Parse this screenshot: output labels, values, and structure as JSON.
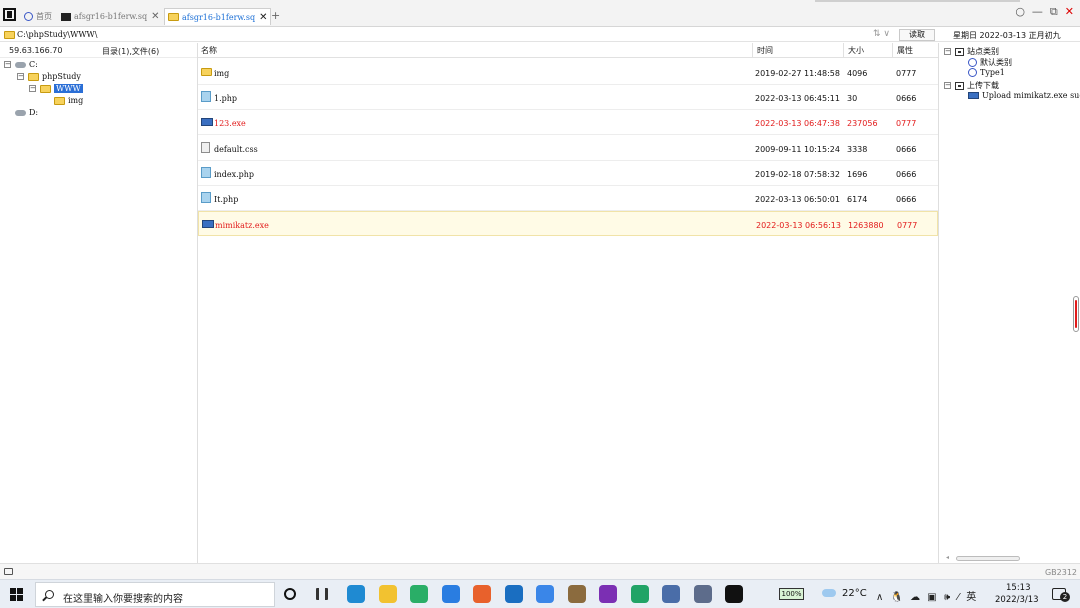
{
  "tabs": [
    {
      "label": "首页",
      "icon": "globe-icon"
    },
    {
      "label": "afsgr16-b1ferw.sq",
      "icon": "terminal-icon"
    },
    {
      "label": "afsgr16-b1ferw.sq",
      "icon": "folder-icon"
    }
  ],
  "window": {
    "minimize": "—",
    "restore": "⧉",
    "close": "✕",
    "circle": "○"
  },
  "address": {
    "path": "C:\\phpStudy\\WWW\\",
    "read_label": "读取",
    "arrows": "⇅ ∨"
  },
  "datetime": "星期日 2022-03-13 正月初九",
  "left": {
    "ip": "59.63.166.70",
    "dir_count": "目录(1),文件(6)",
    "tree": [
      {
        "label": "C:",
        "type": "drive",
        "expander": "⊟"
      },
      {
        "label": "phpStudy",
        "type": "folder",
        "expander": "⊟"
      },
      {
        "label": "WWW",
        "type": "folder",
        "expander": "⊟",
        "selected": true
      },
      {
        "label": "img",
        "type": "folder"
      },
      {
        "label": "D:",
        "type": "drive"
      }
    ]
  },
  "columns": {
    "name": "名称",
    "time": "时间",
    "size": "大小",
    "attr": "属性"
  },
  "files": [
    {
      "name": "img",
      "time": "2019-02-27 11:48:58",
      "size": "4096",
      "attr": "0777",
      "type": "folder",
      "red": false
    },
    {
      "name": "1.php",
      "time": "2022-03-13 06:45:11",
      "size": "30",
      "attr": "0666",
      "type": "php",
      "red": false
    },
    {
      "name": "123.exe",
      "time": "2022-03-13 06:47:38",
      "size": "237056",
      "attr": "0777",
      "type": "exe",
      "red": true
    },
    {
      "name": "default.css",
      "time": "2009-09-11 10:15:24",
      "size": "3338",
      "attr": "0666",
      "type": "css",
      "red": false
    },
    {
      "name": "index.php",
      "time": "2019-02-18 07:58:32",
      "size": "1696",
      "attr": "0666",
      "type": "php",
      "red": false
    },
    {
      "name": "It.php",
      "time": "2022-03-13 06:50:01",
      "size": "6174",
      "attr": "0666",
      "type": "php",
      "red": false
    },
    {
      "name": "mimikatz.exe",
      "time": "2022-03-13 06:56:13",
      "size": "1263880",
      "attr": "0777",
      "type": "exe",
      "red": true,
      "highlight": true
    }
  ],
  "right": {
    "tree": [
      {
        "label": "站点类别",
        "kind": "category",
        "expander": "⊟"
      },
      {
        "label": "默认类别",
        "kind": "item"
      },
      {
        "label": "Type1",
        "kind": "item"
      },
      {
        "label": "上传下载",
        "kind": "category",
        "expander": "⊟"
      },
      {
        "label": "Upload mimikatz.exe suc",
        "kind": "task"
      }
    ]
  },
  "status": {
    "encoding": "GB2312"
  },
  "taskbar": {
    "search_placeholder": "在这里输入你要搜索的内容",
    "battery": "100%",
    "temperature": "22°C",
    "tray_icons": "∧ 🐧 ☁ ▣ 🕪 ⁄ 英",
    "time": "15:13",
    "date": "2022/3/13",
    "notifications": "2",
    "apps": [
      {
        "name": "task-view-icon",
        "color": "#111111"
      },
      {
        "name": "multitask-icon",
        "color": "#333333"
      },
      {
        "name": "edge-icon",
        "color": "#1f8ad2"
      },
      {
        "name": "file-explorer-icon",
        "color": "#f2c230"
      },
      {
        "name": "wechat-icon",
        "color": "#2aae67"
      },
      {
        "name": "l-app-icon",
        "color": "#2a7de1"
      },
      {
        "name": "firefox-icon",
        "color": "#e8612c"
      },
      {
        "name": "mail-icon",
        "color": "#1a6ec1"
      },
      {
        "name": "k-app-icon",
        "color": "#3a86e8"
      },
      {
        "name": "disk-icon",
        "color": "#8b6b3e"
      },
      {
        "name": "onenote-icon",
        "color": "#7b2fb3"
      },
      {
        "name": "pycharm-icon",
        "color": "#21a366"
      },
      {
        "name": "vmware-icon",
        "color": "#4a6da8"
      },
      {
        "name": "network-icon",
        "color": "#5d6c8b"
      },
      {
        "name": "antsword-icon",
        "color": "#111111"
      }
    ]
  }
}
